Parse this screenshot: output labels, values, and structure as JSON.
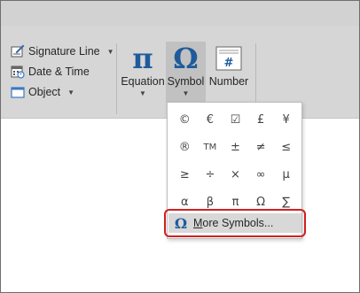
{
  "ribbon": {
    "text_group": {
      "signature_line": {
        "label": "Signature Line",
        "icon": "signature-line-icon"
      },
      "date_time": {
        "label": "Date & Time",
        "icon": "calendar-icon"
      },
      "object": {
        "label": "Object",
        "icon": "object-icon"
      }
    },
    "symbols_group": {
      "equation": {
        "label": "Equation",
        "glyph": "π"
      },
      "symbol": {
        "label": "Symbol",
        "glyph": "Ω"
      },
      "number": {
        "label": "Number",
        "glyph": "#"
      }
    }
  },
  "symbol_menu": {
    "symbols": [
      "©",
      "€",
      "☑",
      "£",
      "¥",
      "®",
      "TM",
      "±",
      "≠",
      "≤",
      "≥",
      "÷",
      "×",
      "∞",
      "µ",
      "α",
      "β",
      "π",
      "Ω",
      "∑"
    ],
    "more_symbols": {
      "label_first": "M",
      "label_rest": "ore Symbols...",
      "glyph": "Ω"
    }
  },
  "colors": {
    "ribbon_bg": "#d6d6d6",
    "accent_blue": "#1f5b9c",
    "highlight_red": "#d21f1f"
  }
}
